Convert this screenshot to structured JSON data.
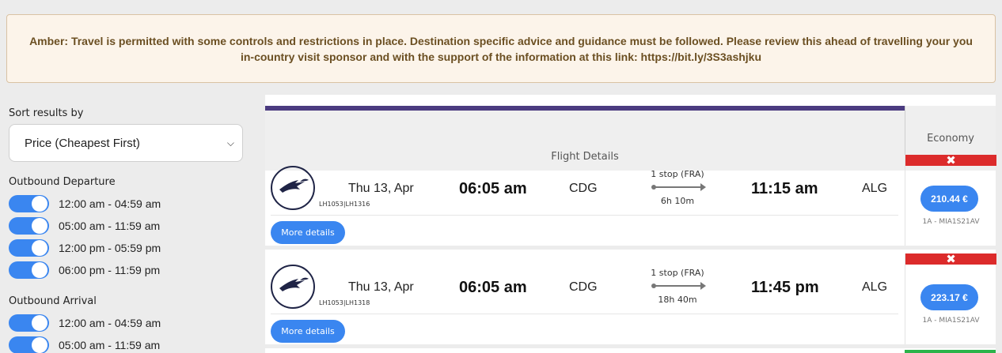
{
  "banner": {
    "text": "Amber: Travel is permitted with some controls and restrictions in place. Destination specific advice and guidance must be followed. Please review this ahead of travelling your you in-country visit sponsor and with the support of the information at this link: https://bit.ly/3S3ashjku"
  },
  "sidebar": {
    "sort_label": "Sort results by",
    "sort_value": "Price (Cheapest First)",
    "outbound_departure": {
      "title": "Outbound Departure",
      "options": [
        "12:00 am - 04:59 am",
        "05:00 am - 11:59 am",
        "12:00 pm - 05:59 pm",
        "06:00 pm - 11:59 pm"
      ]
    },
    "outbound_arrival": {
      "title": "Outbound Arrival",
      "options": [
        "12:00 am - 04:59 am",
        "05:00 am - 11:59 am"
      ]
    }
  },
  "results": {
    "header_left": "Flight Details",
    "header_right": "Economy",
    "flights": [
      {
        "codes": "LH1053|LH1316",
        "date": "Thu 13, Apr",
        "dep_time": "06:05 am",
        "dep_airport": "CDG",
        "stops": "1 stop (FRA)",
        "duration": "6h 10m",
        "arr_time": "11:15 am",
        "arr_airport": "ALG",
        "more_label": "More details",
        "price": "210.44 €",
        "fare_code": "1A - MIA1S21AV"
      },
      {
        "codes": "LH1053|LH1318",
        "date": "Thu 13, Apr",
        "dep_time": "06:05 am",
        "dep_airport": "CDG",
        "stops": "1 stop (FRA)",
        "duration": "18h 40m",
        "arr_time": "11:45 pm",
        "arr_airport": "ALG",
        "more_label": "More details",
        "price": "223.17 €",
        "fare_code": "1A - MIA1S21AV"
      }
    ]
  },
  "colors": {
    "accent": "#3a86f0",
    "warning_bg": "#fcf4ea",
    "warning_text": "#6b4f22",
    "purple_bar": "#4b3b80",
    "unavailable_red": "#dc2b2b",
    "available_green": "#2bb34a"
  },
  "icons": {
    "close": "close-icon",
    "chevron": "chevron-down-icon",
    "airline": "lufthansa-crane-logo"
  }
}
